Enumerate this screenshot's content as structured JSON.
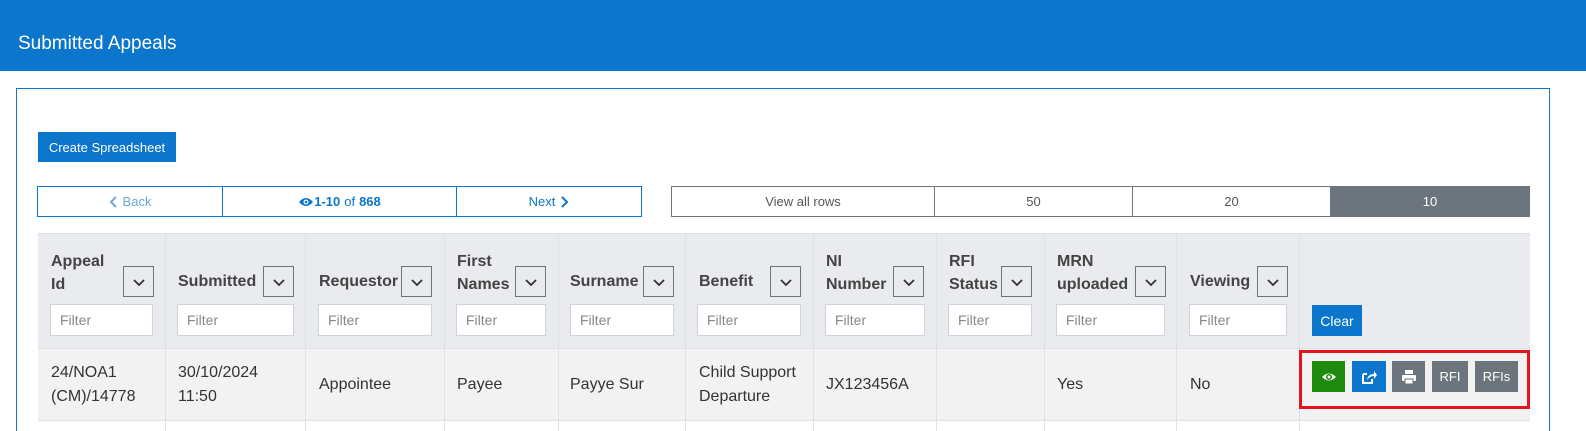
{
  "header": {
    "title": "Submitted Appeals"
  },
  "toolbar": {
    "create_label": "Create Spreadsheet"
  },
  "pager": {
    "back": "Back",
    "range": "1-10",
    "of": "of",
    "total": "868",
    "next": "Next"
  },
  "page_sizes": {
    "all": "View all rows",
    "s50": "50",
    "s20": "20",
    "s10": "10",
    "selected": "10"
  },
  "columns": {
    "appeal_id_1": "Appeal",
    "appeal_id_2": "Id",
    "submitted": "Submitted",
    "requestor": "Requestor",
    "first_names_1": "First",
    "first_names_2": "Names",
    "surname": "Surname",
    "benefit": "Benefit",
    "ni_1": "NI",
    "ni_2": "Number",
    "rfi_1": "RFI",
    "rfi_2": "Status",
    "mrn_1": "MRN",
    "mrn_2": "uploaded",
    "viewing": "Viewing"
  },
  "filter_placeholder": "Filter",
  "clear_label": "Clear",
  "row": {
    "appeal_id_1": "24/NOA1",
    "appeal_id_2": "(CM)/14778",
    "submitted_1": "30/10/2024",
    "submitted_2": "11:50",
    "requestor": "Appointee",
    "first_names": "Payee",
    "surname": "Payye Sur",
    "benefit_1": "Child Support",
    "benefit_2": "Departure",
    "ni_number": "JX123456A",
    "rfi_status": "",
    "mrn_uploaded": "Yes",
    "viewing": "No"
  },
  "actions": {
    "rfi": "RFI",
    "rfis": "RFIs"
  },
  "colors": {
    "primary": "#0b76cc",
    "success": "#1e8a0e",
    "secondary": "#6c757d",
    "highlight": "#e3141d"
  },
  "icons": [
    "eye-icon",
    "share-icon",
    "print-icon",
    "chevron-left-icon",
    "chevron-right-icon",
    "chevron-down-icon"
  ]
}
